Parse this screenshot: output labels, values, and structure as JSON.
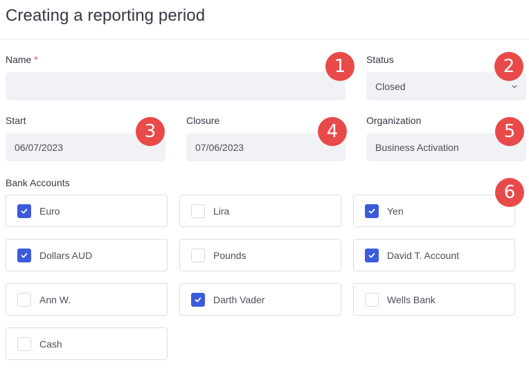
{
  "page": {
    "title": "Creating a reporting period"
  },
  "form": {
    "name": {
      "label": "Name",
      "required_mark": "*",
      "value": "",
      "placeholder": ""
    },
    "status": {
      "label": "Status",
      "value": "Closed"
    },
    "start": {
      "label": "Start",
      "value": "06/07/2023"
    },
    "closure": {
      "label": "Closure",
      "value": "07/06/2023"
    },
    "organization": {
      "label": "Organization",
      "value": "Business Activation"
    }
  },
  "bank_accounts": {
    "label": "Bank Accounts",
    "items": [
      {
        "label": "Euro",
        "checked": true
      },
      {
        "label": "Lira",
        "checked": false
      },
      {
        "label": "Yen",
        "checked": true
      },
      {
        "label": "Dollars AUD",
        "checked": true
      },
      {
        "label": "Pounds",
        "checked": false
      },
      {
        "label": "David T. Account",
        "checked": true
      },
      {
        "label": "Ann W.",
        "checked": false
      },
      {
        "label": "Darth Vader",
        "checked": true
      },
      {
        "label": "Wells Bank",
        "checked": false
      },
      {
        "label": "Cash",
        "checked": false
      }
    ]
  },
  "badges": [
    "1",
    "2",
    "3",
    "4",
    "5",
    "6"
  ],
  "colors": {
    "accent": "#3b5bdb",
    "badge": "#e84a4a",
    "required": "#e5484d",
    "field_bg": "#f1f2f6"
  }
}
